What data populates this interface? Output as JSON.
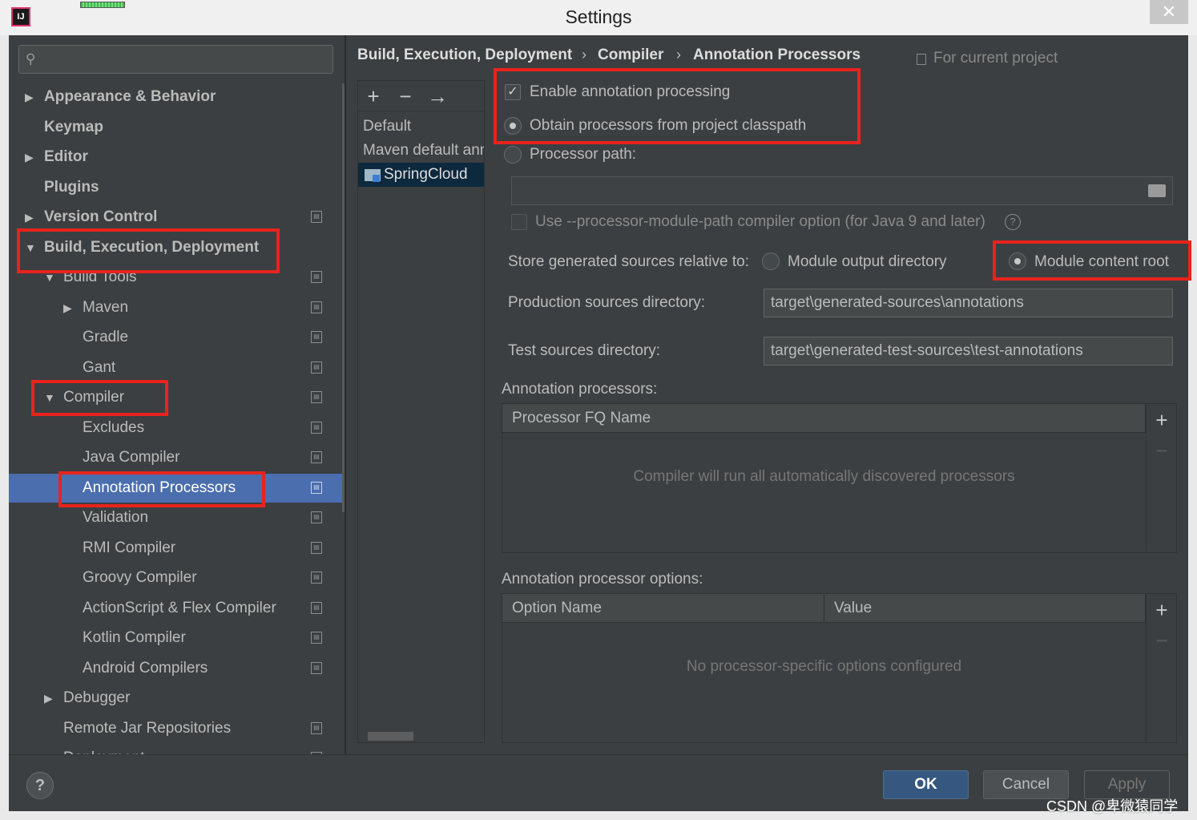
{
  "window": {
    "title": "Settings",
    "close": "✕"
  },
  "tree": [
    {
      "label": "Appearance & Behavior",
      "arrow": "▶"
    },
    {
      "label": "Keymap",
      "arrow": ""
    },
    {
      "label": "Editor",
      "arrow": "▶"
    },
    {
      "label": "Plugins",
      "arrow": ""
    },
    {
      "label": "Version Control",
      "arrow": "▶"
    },
    {
      "label": "Build, Execution, Deployment",
      "arrow": "▼"
    },
    {
      "label": "Build Tools",
      "arrow": "▼"
    },
    {
      "label": "Maven",
      "arrow": "▶"
    },
    {
      "label": "Gradle",
      "arrow": ""
    },
    {
      "label": "Gant",
      "arrow": ""
    },
    {
      "label": "Compiler",
      "arrow": "▼"
    },
    {
      "label": "Excludes",
      "arrow": ""
    },
    {
      "label": "Java Compiler",
      "arrow": ""
    },
    {
      "label": "Annotation Processors",
      "arrow": ""
    },
    {
      "label": "Validation",
      "arrow": ""
    },
    {
      "label": "RMI Compiler",
      "arrow": ""
    },
    {
      "label": "Groovy Compiler",
      "arrow": ""
    },
    {
      "label": "ActionScript & Flex Compiler",
      "arrow": ""
    },
    {
      "label": "Kotlin Compiler",
      "arrow": ""
    },
    {
      "label": "Android Compilers",
      "arrow": ""
    },
    {
      "label": "Debugger",
      "arrow": "▶"
    },
    {
      "label": "Remote Jar Repositories",
      "arrow": ""
    },
    {
      "label": "Deployment",
      "arrow": "▶"
    }
  ],
  "breadcrumb": {
    "items": [
      "Build, Execution, Deployment",
      "Compiler",
      "Annotation Processors"
    ],
    "separator": "›",
    "scope": "For current project"
  },
  "profiles": {
    "toolbar": {
      "add": "+",
      "remove": "−",
      "move": "→"
    },
    "items": [
      "Default",
      "Maven default annotation processors profile",
      "SpringCloud"
    ]
  },
  "options": {
    "enable_label": "Enable annotation processing",
    "enable_checked": true,
    "classpath_label": "Obtain processors from project classpath",
    "processor_path_label": "Processor path:",
    "processor_path_value": "",
    "module_path_label": "Use --processor-module-path compiler option (for Java 9 and later)",
    "help": "?",
    "store_label": "Store generated sources relative to:",
    "module_output_label": "Module output directory",
    "module_content_label": "Module content root",
    "production_label": "Production sources directory:",
    "production_value": "target\\generated-sources\\annotations",
    "test_label": "Test sources directory:",
    "test_value": "target\\generated-test-sources\\test-annotations"
  },
  "processors_table": {
    "title": "Annotation processors:",
    "column": "Processor FQ Name",
    "empty": "Compiler will run all automatically discovered processors",
    "add": "+",
    "remove": "−"
  },
  "options_table": {
    "title": "Annotation processor options:",
    "columns": [
      "Option Name",
      "Value"
    ],
    "empty": "No processor-specific options configured",
    "add": "+",
    "remove": "−"
  },
  "buttons": {
    "help": "?",
    "ok": "OK",
    "cancel": "Cancel",
    "apply": "Apply"
  },
  "watermark": "CSDN @卑微猿同学",
  "colors": {
    "highlight": "#e8231d",
    "selected": "#4b6eaf",
    "panel": "#3c3f41"
  }
}
